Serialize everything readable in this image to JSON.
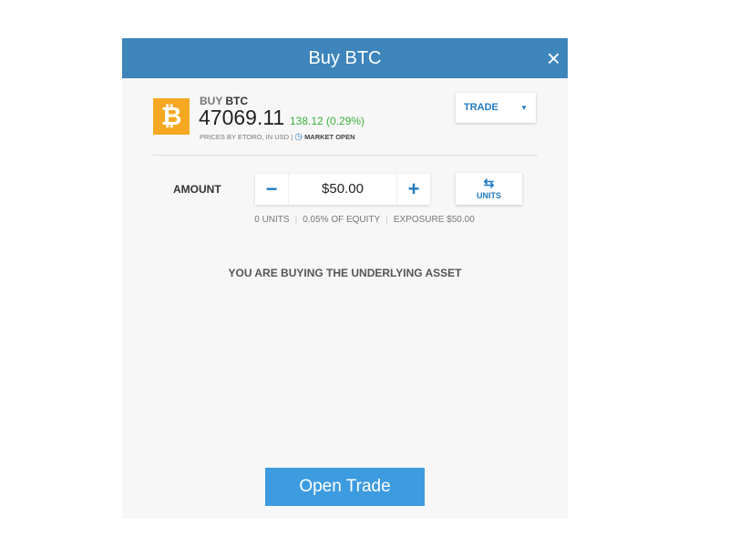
{
  "header": {
    "title": "Buy BTC",
    "close_icon": "×"
  },
  "asset": {
    "logo": "₿",
    "action": "BUY",
    "symbol": "BTC",
    "price": "47069.11",
    "change": "138.12 (0.29%)",
    "source": "PRICES BY ETORO, IN USD",
    "separator": "|",
    "clock_icon": "◷",
    "market_status": "MARKET OPEN"
  },
  "trade_select": {
    "label": "TRADE",
    "caret": "▼"
  },
  "amount": {
    "label": "AMOUNT",
    "minus": "−",
    "value": "$50.00",
    "plus": "+",
    "units_icon": "⇆",
    "units_label": "UNITS"
  },
  "info": {
    "units": "0 UNITS",
    "equity": "0.05% OF EQUITY",
    "exposure": "EXPOSURE $50.00",
    "sep": "|"
  },
  "note": "YOU ARE BUYING THE UNDERLYING ASSET",
  "open_trade": "Open Trade",
  "colors": {
    "header": "#3d85bb",
    "accent": "#1f7ac2",
    "positive": "#3ab03e",
    "btc": "#f7a823"
  }
}
